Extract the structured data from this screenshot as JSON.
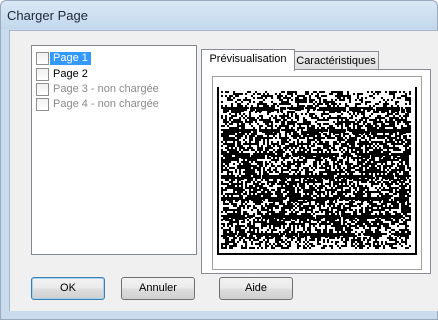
{
  "window": {
    "title": "Charger Page"
  },
  "pages": [
    {
      "label": "Page 1",
      "checked": false,
      "selected": true,
      "enabled": true
    },
    {
      "label": "Page 2",
      "checked": false,
      "selected": false,
      "enabled": true
    },
    {
      "label": "Page 3 - non chargée",
      "checked": false,
      "selected": false,
      "enabled": false
    },
    {
      "label": "Page 4 - non chargée",
      "checked": false,
      "selected": false,
      "enabled": false
    }
  ],
  "tabs": [
    {
      "label": "Prévisualisation",
      "active": true
    },
    {
      "label": "Caractéristiques",
      "active": false
    }
  ],
  "buttons": {
    "ok": "OK",
    "cancel": "Annuler",
    "help": "Aide"
  },
  "colors": {
    "selection": "#3399ff",
    "titlebar": "#c9dced",
    "dialog_bg": "#f0f0f0"
  }
}
